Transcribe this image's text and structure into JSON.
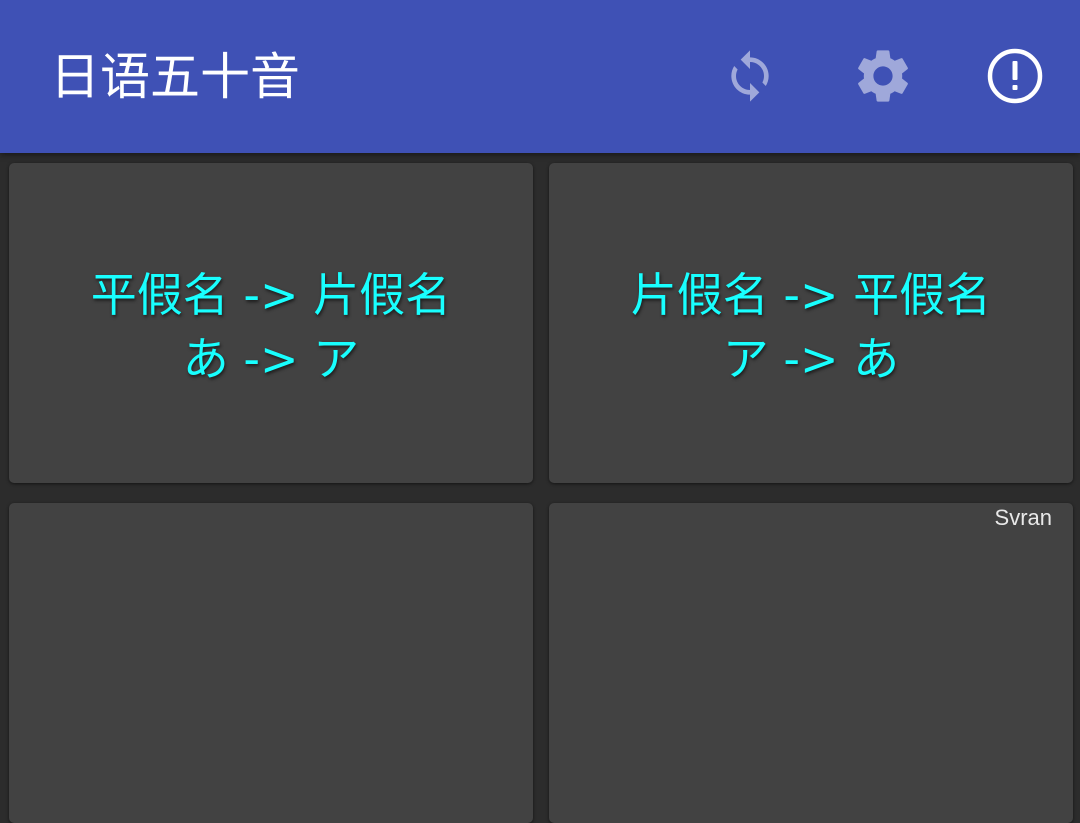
{
  "appbar": {
    "title": "日语五十音",
    "color": "#3f51b5",
    "actions": [
      {
        "icon": "sync-icon",
        "label": "sync",
        "color": "#9fa8da"
      },
      {
        "icon": "gear-icon",
        "label": "settings",
        "color": "#9fa8da"
      },
      {
        "icon": "info-icon",
        "label": "about",
        "color": "#ffffff"
      }
    ]
  },
  "cards": [
    {
      "line1": "平假名 -> 片假名",
      "line2": "あ -> ア"
    },
    {
      "line1": "片假名 -> 平假名",
      "line2": "ア -> あ"
    },
    {
      "line1": "",
      "line2": ""
    },
    {
      "line1": "",
      "line2": ""
    }
  ],
  "watermark": "Svran",
  "colors": {
    "card_text": "#18ffff",
    "card_bg": "#424242",
    "background": "#2c2c2c"
  }
}
